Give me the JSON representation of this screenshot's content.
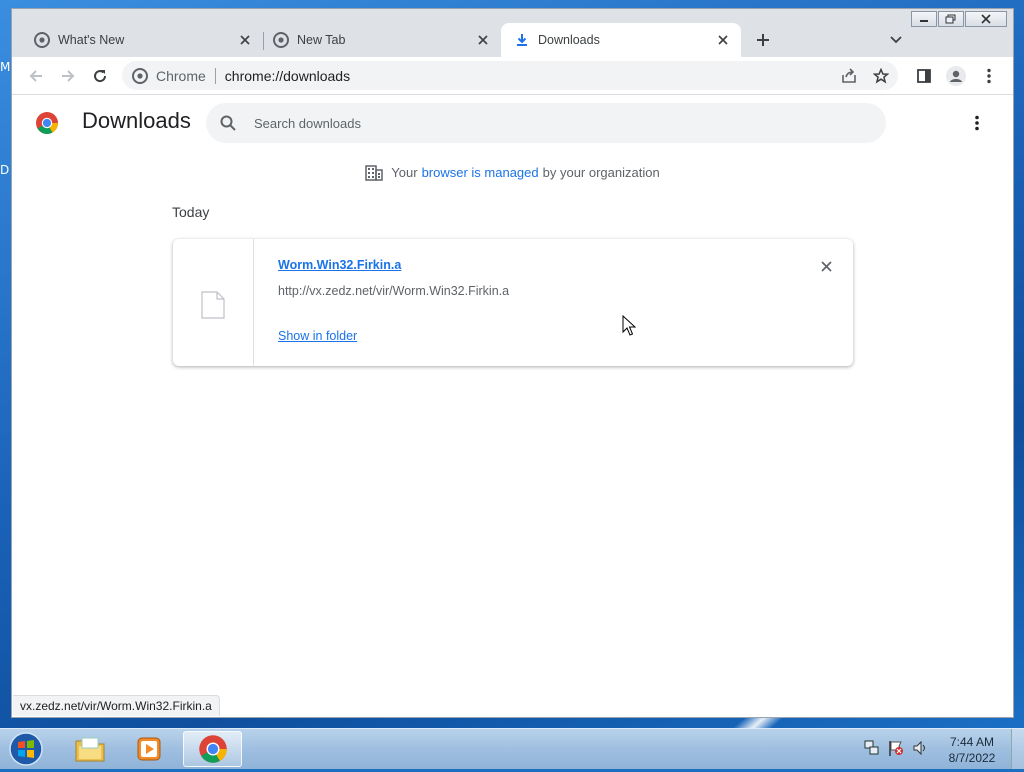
{
  "desktop": {
    "left_labels": [
      "M",
      "D"
    ]
  },
  "browser": {
    "tabs": [
      {
        "label": "What's New",
        "active": false,
        "icon": "chrome-icon"
      },
      {
        "label": "New Tab",
        "active": false,
        "icon": "chrome-icon"
      },
      {
        "label": "Downloads",
        "active": true,
        "icon": "download-icon"
      }
    ],
    "omnibox": {
      "site_label": "Chrome",
      "url": "chrome://downloads"
    }
  },
  "downloads_page": {
    "title": "Downloads",
    "search_placeholder": "Search downloads",
    "managed_notice": {
      "prefix": "Your",
      "link": "browser is managed",
      "suffix": "by your organization"
    },
    "sections": [
      {
        "date": "Today",
        "items": [
          {
            "file_name": "Worm.Win32.Firkin.a",
            "url": "http://vx.zedz.net/vir/Worm.Win32.Firkin.a",
            "action": "Show in folder"
          }
        ]
      }
    ]
  },
  "status_bar": {
    "text": "vx.zedz.net/vir/Worm.Win32.Firkin.a"
  },
  "taskbar": {
    "clock_time": "7:44 AM",
    "clock_date": "8/7/2022",
    "apps": [
      "windows-explorer-icon",
      "media-player-icon",
      "chrome-icon"
    ]
  },
  "colors": {
    "accent": "#1a73e8",
    "tab_strip": "#dee1e6",
    "taskbar": "#a9c6e4"
  }
}
